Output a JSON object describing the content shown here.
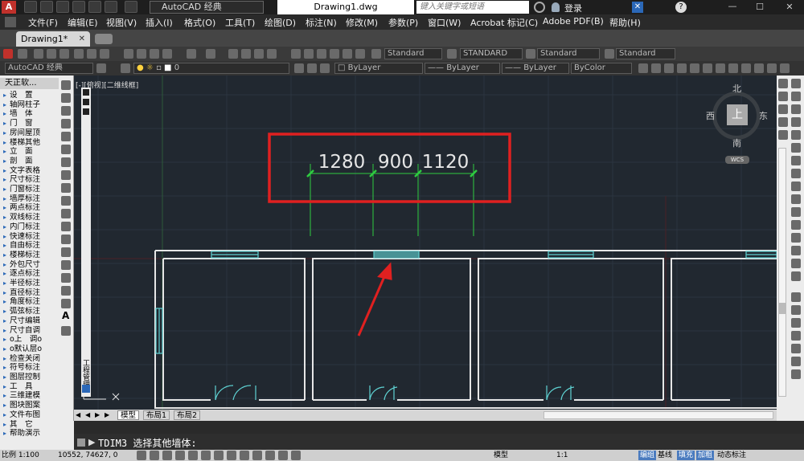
{
  "titlebar": {
    "workspace": "AutoCAD 经典",
    "document_title": "Drawing1.dwg",
    "search_placeholder": "键入关键字或短语",
    "login": "登录"
  },
  "menu": [
    "文件(F)",
    "编辑(E)",
    "视图(V)",
    "插入(I)",
    "格式(O)",
    "工具(T)",
    "绘图(D)",
    "标注(N)",
    "修改(M)",
    "参数(P)",
    "窗口(W)",
    "Acrobat 标记(C)",
    "Adobe PDF(B)",
    "帮助(H)"
  ],
  "doc_tab": "Drawing1*",
  "toolbar1": {
    "text_style": "Standard",
    "dim_style": "STANDARD",
    "table_style": "Standard",
    "mleader_style": "Standard"
  },
  "toolbar2": {
    "workspace": "AutoCAD 经典",
    "layer": "0",
    "color": "ByLayer",
    "linetype": "ByLayer",
    "lineweight": "ByLayer",
    "plotstyle": "ByColor"
  },
  "left_panel": {
    "title": "天正软...",
    "items": [
      "设　置",
      "轴网柱子",
      "墙　体",
      "门　窗",
      "房间屋顶",
      "楼梯其他",
      "立　面",
      "剖　面",
      "文字表格",
      "尺寸标注",
      "门窗标注",
      "墙厚标注",
      "两点标注",
      "双线标注",
      "内门标注",
      "快速标注",
      "自由标注",
      "楼梯标注",
      "外包尺寸",
      "逐点标注",
      "半径标注",
      "直径标注",
      "角度标注",
      "弧弦标注",
      "尺寸编辑",
      "尺寸自调",
      "o上　调o",
      "o默认层o",
      "检查关闭",
      "符号标注",
      "图层控制",
      "工　具",
      "三维建模",
      "图块图案",
      "文件布图",
      "其　它",
      "帮助演示"
    ]
  },
  "viewport": {
    "view_label": "[-][俯视][二维线框]",
    "side_label": "工程管理",
    "dimensions": [
      "1280",
      "900",
      "1120"
    ],
    "viewcube": {
      "north": "北",
      "south": "南",
      "east": "东",
      "west": "西",
      "top": "上",
      "wcs": "WCS"
    }
  },
  "layout_tabs": [
    "模型",
    "布局1",
    "布局2"
  ],
  "command_line": "TDIM3 选择其他墙体:",
  "status": {
    "scale": "比例 1:100",
    "coords": "10552, 74627, 0",
    "model": "模型",
    "ratio": "1:1",
    "buttons": [
      "编组",
      "基线",
      "填充",
      "加粗",
      "动态标注"
    ]
  },
  "colors": {
    "highlight_box": "#e02020",
    "dimension": "#2ecc40",
    "wall": "#e6e6e6",
    "window": "#5fd3d3",
    "arrow": "#e02020"
  }
}
